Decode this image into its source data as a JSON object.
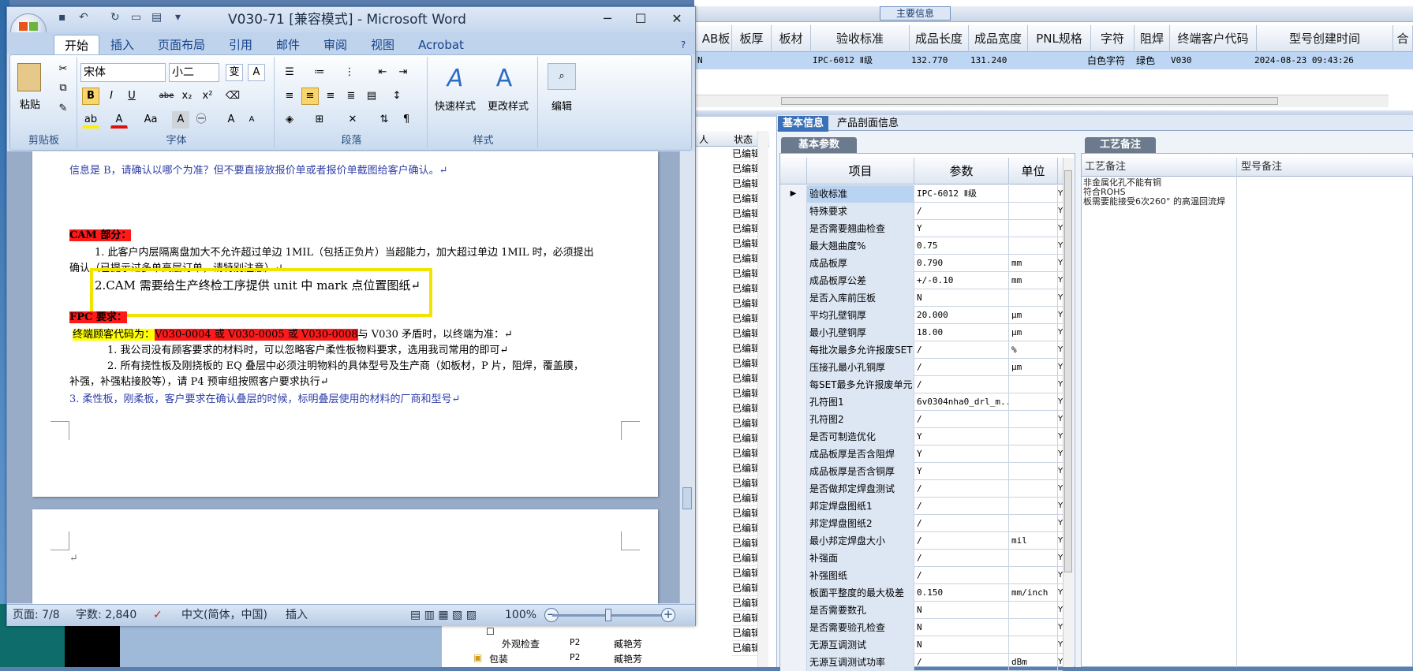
{
  "word": {
    "title": "V030-71 [兼容模式] - Microsoft Word",
    "qat_items": [
      "save",
      "undo",
      "redo",
      "open",
      "print"
    ],
    "tabs": [
      "开始",
      "插入",
      "页面布局",
      "引用",
      "邮件",
      "审阅",
      "视图",
      "Acrobat"
    ],
    "clipboard": {
      "paste": "粘贴",
      "group": "剪贴板"
    },
    "font": {
      "name": "宋体",
      "size": "小二",
      "group": "字体",
      "bold": "B",
      "italic": "I",
      "underline": "U",
      "strike": "abe",
      "sub": "x₂",
      "sup": "x²",
      "grow": "A",
      "shrink": "A",
      "case": "Aa"
    },
    "paragraph": {
      "group": "段落"
    },
    "styles": {
      "quick": "快速样式",
      "change": "更改样式",
      "group": "样式"
    },
    "editing": {
      "label": "编辑"
    },
    "doc_lines": [
      "信息是 B，请确认以哪个为准？但不要直接放报价单或者报价单截图给客户确认。↵",
      "CAM 部分：",
      "1. 此客户内层隔离盘加大不允许超过单边 1MIL（包括正负片）当超能力，加大超过单边 1MIL 时，必须提出",
      "确认（已提示过多单高层订单，请特别注意）↵",
      "2.CAM 需要给生产终检工序提供 unit 中 mark 点位置图纸↵",
      "FPC 要求：",
      "终端顾客代码为：",
      "V030-0004 或 V030-0005 或 V030-0008",
      "与 V030 矛盾时，以终端为准：↵",
      "1.  我公司没有顾客要求的材料时，可以忽略客户柔性板物料要求，选用我司常用的即可↵",
      "2.  所有挠性板及刚挠板的 EQ 叠层中必须注明物料的具体型号及生产商（如板材，P 片，阻焊，覆盖膜，",
      "补强，补强粘接胶等），请 P4 预审组按照客户要求执行↵",
      "3. 柔性板，刚柔板，客户要求在确认叠层的时候，标明叠层使用的材料的厂商和型号↵"
    ],
    "status": {
      "page": "页面: 7/8",
      "words": "字数: 2,840",
      "language": "中文(简体，中国)",
      "mode": "插入",
      "zoom": "100%"
    }
  },
  "grid": {
    "caption": "主要信息",
    "columns": [
      "AB板",
      "板厚",
      "板材",
      "验收标准",
      "成品长度",
      "成品宽度",
      "PNL规格",
      "字符",
      "阻焊",
      "终端客户代码",
      "型号创建时间",
      "合"
    ],
    "row": {
      "lead": "N",
      "standard": "IPC-6012 Ⅱ级",
      "length": "132.770",
      "width": "131.240",
      "char": "白色字符",
      "mask": "绿色",
      "customer": "V030",
      "created": "2024-08-23 09:43:26"
    }
  },
  "mid": {
    "header_left": "人",
    "header_status": "状态",
    "status_value": "已编辑",
    "tree": [
      {
        "name": "外观检查",
        "code": "P2",
        "user": "臧艳芳"
      },
      {
        "name": "包装",
        "code": "P2",
        "user": "臧艳芳"
      }
    ]
  },
  "tabs": {
    "basic": "基本信息",
    "profile": "产品剖面信息",
    "basic_params": "基本参数",
    "craft": "工艺备注"
  },
  "params": {
    "headers": [
      "项目",
      "参数",
      "单位"
    ],
    "rows": [
      {
        "item": "验收标准",
        "param": "IPC-6012 Ⅱ级",
        "unit": ""
      },
      {
        "item": "特殊要求",
        "param": "/",
        "unit": ""
      },
      {
        "item": "是否需要翘曲检查",
        "param": "Y",
        "unit": ""
      },
      {
        "item": "最大翘曲度%",
        "param": "0.75",
        "unit": ""
      },
      {
        "item": "成品板厚",
        "param": "0.790",
        "unit": "mm"
      },
      {
        "item": "成品板厚公差",
        "param": "+/-0.10",
        "unit": "mm"
      },
      {
        "item": "是否入库前压板",
        "param": "N",
        "unit": ""
      },
      {
        "item": "平均孔壁铜厚",
        "param": "20.000",
        "unit": "μm"
      },
      {
        "item": "最小孔壁铜厚",
        "param": "18.00",
        "unit": "μm"
      },
      {
        "item": "每批次最多允许报废SET",
        "param": "/",
        "unit": "%"
      },
      {
        "item": "压接孔最小孔铜厚",
        "param": "/",
        "unit": "μm"
      },
      {
        "item": "每SET最多允许报废单元",
        "param": "/",
        "unit": ""
      },
      {
        "item": "孔符图1",
        "param": "6v0304nha0_drl_m...",
        "unit": ""
      },
      {
        "item": "孔符图2",
        "param": "/",
        "unit": ""
      },
      {
        "item": "是否可制造优化",
        "param": "Y",
        "unit": ""
      },
      {
        "item": "成品板厚是否含阻焊",
        "param": "Y",
        "unit": ""
      },
      {
        "item": "成品板厚是否含铜厚",
        "param": "Y",
        "unit": ""
      },
      {
        "item": "是否做邦定焊盘测试",
        "param": "/",
        "unit": ""
      },
      {
        "item": "邦定焊盘图纸1",
        "param": "/",
        "unit": ""
      },
      {
        "item": "邦定焊盘图纸2",
        "param": "/",
        "unit": ""
      },
      {
        "item": "最小邦定焊盘大小",
        "param": "/",
        "unit": "mil"
      },
      {
        "item": "补强面",
        "param": "/",
        "unit": ""
      },
      {
        "item": "补强图纸",
        "param": "/",
        "unit": ""
      },
      {
        "item": "板面平整度的最大极差",
        "param": "0.150",
        "unit": "mm/inch"
      },
      {
        "item": "是否需要数孔",
        "param": "N",
        "unit": ""
      },
      {
        "item": "是否需要验孔检查",
        "param": "N",
        "unit": ""
      },
      {
        "item": "无源互调测试",
        "param": "N",
        "unit": ""
      },
      {
        "item": "无源互调测试功率",
        "param": "/",
        "unit": "dBm"
      }
    ],
    "y_flag": "Y"
  },
  "craft": {
    "headers": [
      "工艺备注",
      "型号备注"
    ],
    "note": "非金属化孔不能有铜\n符合ROHS\n板需要能接受6次260° 的高温回流焊"
  }
}
